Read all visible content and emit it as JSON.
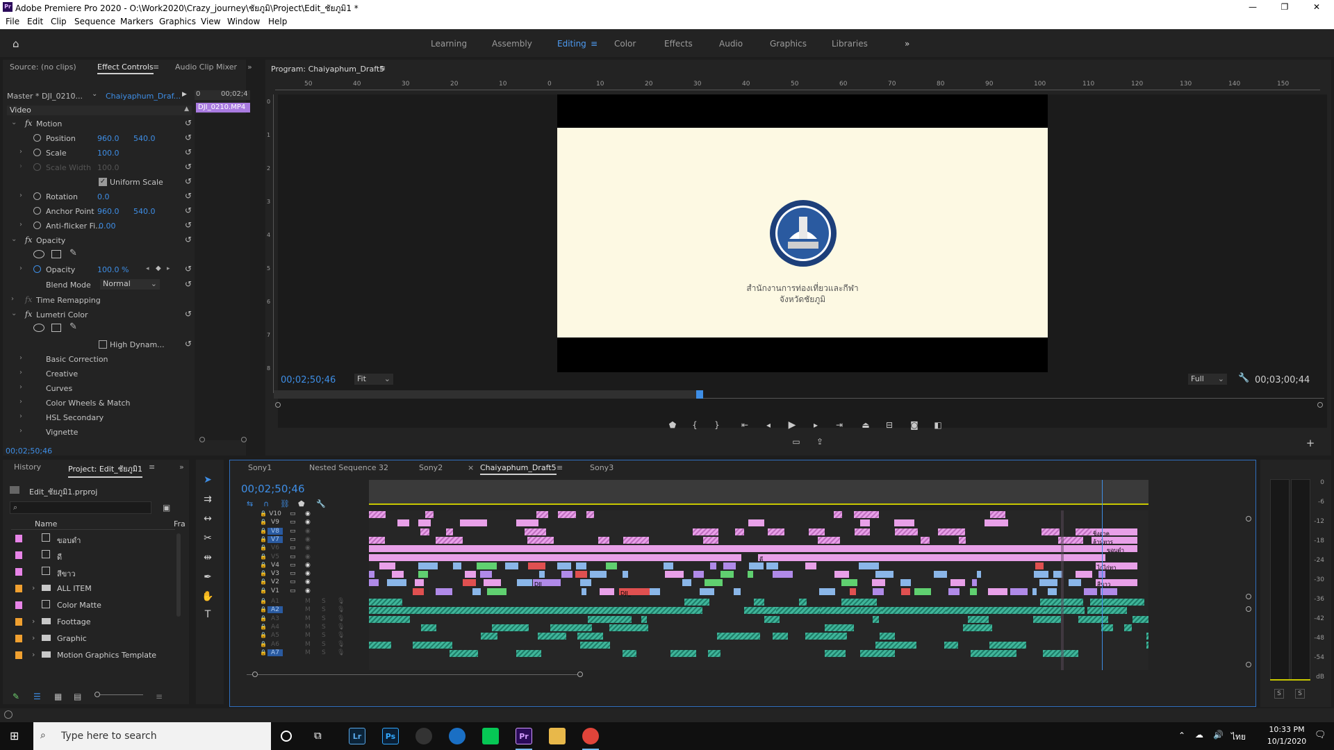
{
  "window": {
    "app_initials": "Pr",
    "title": "Adobe Premiere Pro 2020 - O:\\Work2020\\Crazy_journey\\ชัยภูมิ\\Project\\Edit_ชัยภูมิ1 *",
    "minimize": "—",
    "restore": "❐",
    "close": "✕"
  },
  "menu": [
    "File",
    "Edit",
    "Clip",
    "Sequence",
    "Markers",
    "Graphics",
    "View",
    "Window",
    "Help"
  ],
  "workspaces": {
    "tabs": [
      "Learning",
      "Assembly",
      "Editing",
      "Color",
      "Effects",
      "Audio",
      "Graphics",
      "Libraries"
    ],
    "active": "Editing",
    "more": "»"
  },
  "source_panel": {
    "tabs": [
      "Source: (no clips)",
      "Effect Controls",
      "Audio Clip Mixer"
    ],
    "active_tab": "Effect Controls",
    "master_label": "Master * DJI_0210...",
    "sequence_label": "Chaiyaphum_Draf...",
    "mini_timecode": "00;02;4",
    "mini_start": "0",
    "clip_name": "DJI_0210.MP4",
    "video_header": "Video",
    "motion": {
      "label": "Motion",
      "position_label": "Position",
      "position_x": "960.0",
      "position_y": "540.0",
      "scale_label": "Scale",
      "scale": "100.0",
      "scale_width_label": "Scale Width",
      "scale_width": "100.0",
      "uniform_scale_label": "Uniform Scale",
      "rotation_label": "Rotation",
      "rotation": "0.0",
      "anchor_label": "Anchor Point",
      "anchor_x": "960.0",
      "anchor_y": "540.0",
      "antiflicker_label": "Anti-flicker Fi...",
      "antiflicker": "0.00"
    },
    "opacity": {
      "label": "Opacity",
      "opacity_label": "Opacity",
      "opacity_value": "100.0 %",
      "blend_label": "Blend Mode",
      "blend_value": "Normal"
    },
    "time_remapping": "Time Remapping",
    "lumetri": {
      "label": "Lumetri Color",
      "high_dynamic": "High Dynam...",
      "sections": [
        "Basic Correction",
        "Creative",
        "Curves",
        "Color Wheels & Match",
        "HSL Secondary",
        "Vignette"
      ]
    },
    "footer_timecode": "00;02;50;46"
  },
  "program_monitor": {
    "title": "Program: Chaiyaphum_Draft5",
    "ruler_labels": [
      "50",
      "40",
      "30",
      "20",
      "10",
      "0",
      "10",
      "20",
      "30",
      "40",
      "50",
      "60",
      "70",
      "80",
      "90",
      "100",
      "110",
      "120",
      "130",
      "140",
      "150"
    ],
    "side_ruler_labels": [
      "0",
      "1",
      "2",
      "3",
      "4",
      "5",
      "6",
      "7",
      "8"
    ],
    "frame_text_line1": "สำนักงานการท่องเที่ยวและกีฬา",
    "frame_text_line2": "จังหวัดชัยภูมิ",
    "current_timecode": "00;02;50;46",
    "zoom": "Fit",
    "resolution": "Full",
    "duration_timecode": "00;03;00;44",
    "playhead_fraction": 0.475,
    "add_button": "+"
  },
  "project_panel": {
    "tabs": [
      "History",
      "Project: Edit_ชัยภูมิ1"
    ],
    "active_tab": "Project: Edit_ชัยภูมิ1",
    "project_file": "Edit_ชัยภูมิ1.prproj",
    "search_placeholder": "",
    "col_name": "Name",
    "col_frame": "Fra",
    "items": [
      {
        "name": "ขอบดำ",
        "type": "sequence",
        "color": "#e884e8",
        "expandable": false
      },
      {
        "name": "ดี",
        "type": "sequence",
        "color": "#e884e8",
        "expandable": false
      },
      {
        "name": "สีขาว",
        "type": "sequence",
        "color": "#e884e8",
        "expandable": false
      },
      {
        "name": "ALL ITEM",
        "type": "folder",
        "color": "#f0a030",
        "expandable": true
      },
      {
        "name": "Color Matte",
        "type": "sequence",
        "color": "#e884e8",
        "expandable": false
      },
      {
        "name": "Foottage",
        "type": "folder",
        "color": "#f0a030",
        "expandable": true
      },
      {
        "name": "Graphic",
        "type": "folder",
        "color": "#f0a030",
        "expandable": true
      },
      {
        "name": "Motion Graphics Template",
        "type": "folder",
        "color": "#f0a030",
        "expandable": true
      }
    ]
  },
  "timeline": {
    "tabs": [
      "Sony1",
      "Nested Sequence 32",
      "Sony2",
      "Chaiyaphum_Draft5",
      "Sony3"
    ],
    "active_tab": "Chaiyaphum_Draft5",
    "timecode": "00;02;50;46",
    "video_tracks": [
      "V10",
      "V9",
      "V8",
      "V7",
      "V6",
      "V5",
      "V4",
      "V3",
      "V2",
      "V1"
    ],
    "audio_tracks": [
      "A1",
      "A2",
      "A3",
      "A4",
      "A5",
      "A6",
      "A7"
    ],
    "playhead_fraction": 0.94,
    "clip_labels": {
      "thai1": "ชิ่งอาค",
      "thai2": "ล้าน์ทาร",
      "thai3": "ขอบดำ",
      "thai4": "ไก่ไก่ทา",
      "thai5": "สีขาว",
      "v5label": "ดี",
      "dji1": "DJI",
      "dji2": "DJI_"
    }
  },
  "audio_meter": {
    "labels": [
      "0",
      "-6",
      "-12",
      "-18",
      "-24",
      "-30",
      "-36",
      "-42",
      "-48",
      "-54",
      "dB"
    ],
    "solo_left": "S",
    "solo_right": "S"
  },
  "taskbar": {
    "search_placeholder": "Type here to search",
    "apps": [
      "Lr",
      "Ps",
      "Pr"
    ],
    "lang": "ไทย",
    "time": "10:33 PM",
    "date": "10/1/2020"
  },
  "colors": {
    "accent_blue": "#3e8ee6",
    "panel_bg": "#232323",
    "pink_clip": "#e8a0e8",
    "audio_clip": "#3fb59a"
  }
}
